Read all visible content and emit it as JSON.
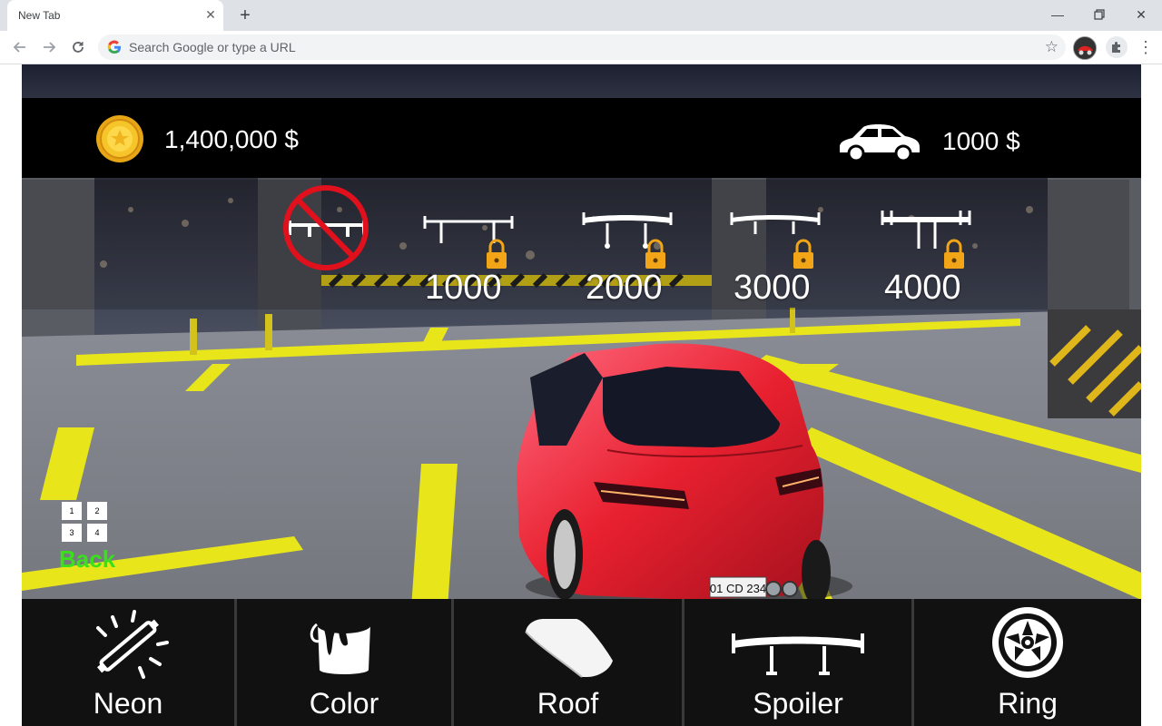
{
  "browser": {
    "tab_title": "New Tab",
    "omnibox_placeholder": "Search Google or type a URL"
  },
  "game": {
    "balance": "1,400,000 $",
    "car_price": "1000 $",
    "spoilers": [
      {
        "id": "none",
        "price": "",
        "locked": false
      },
      {
        "id": "spoiler-1",
        "price": "1000",
        "locked": true
      },
      {
        "id": "spoiler-2",
        "price": "2000",
        "locked": true
      },
      {
        "id": "spoiler-3",
        "price": "3000",
        "locked": true
      },
      {
        "id": "spoiler-4",
        "price": "4000",
        "locked": true
      }
    ],
    "back_grid": [
      "1",
      "2",
      "3",
      "4"
    ],
    "back_label": "Back",
    "plate": "01 CD 234",
    "menu": [
      {
        "label": "Neon",
        "icon": "neon-tube-icon"
      },
      {
        "label": "Color",
        "icon": "paint-bucket-icon"
      },
      {
        "label": "Roof",
        "icon": "roof-panel-icon"
      },
      {
        "label": "Spoiler",
        "icon": "spoiler-icon"
      },
      {
        "label": "Ring",
        "icon": "wheel-rim-icon"
      }
    ]
  },
  "colors": {
    "back_green": "#3ae01a",
    "car_red": "#e8202f",
    "lock_gold": "#f2a516",
    "parking_yellow": "#e8e61a"
  }
}
